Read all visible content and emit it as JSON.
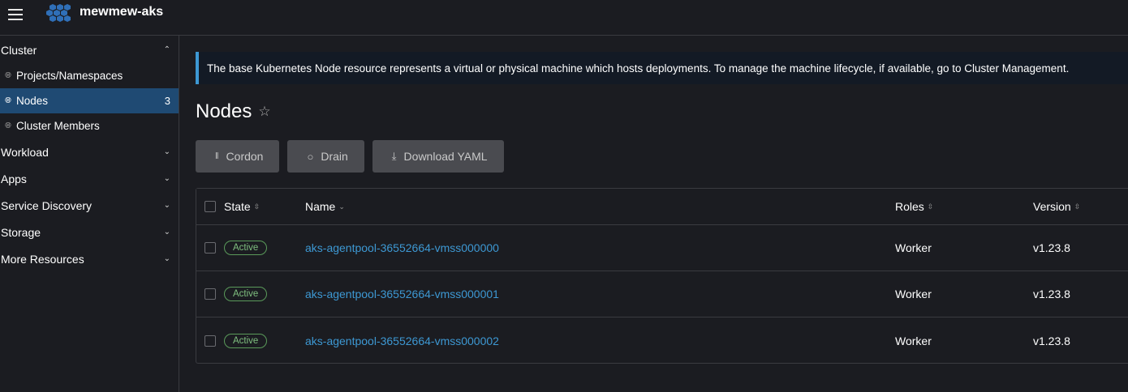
{
  "header": {
    "title": "mewmew-aks",
    "menu_icon": "hamburger-icon",
    "logo_icon": "kubernetes-cluster-logo"
  },
  "sidebar": {
    "groups": [
      {
        "label": "Cluster",
        "expanded": true,
        "items": [
          {
            "label": "Projects/Namespaces",
            "icon": "globe-icon"
          },
          {
            "label": "Nodes",
            "icon": "globe-icon",
            "count": "3",
            "active": true
          },
          {
            "label": "Cluster Members",
            "icon": "globe-icon"
          }
        ]
      },
      {
        "label": "Workload",
        "expanded": false
      },
      {
        "label": "Apps",
        "expanded": false
      },
      {
        "label": "Service Discovery",
        "expanded": false
      },
      {
        "label": "Storage",
        "expanded": false
      },
      {
        "label": "More Resources",
        "expanded": false
      }
    ]
  },
  "banner": {
    "text": "The base Kubernetes Node resource represents a virtual or physical machine which hosts deployments. To manage the machine lifecycle, if available, go to Cluster Management."
  },
  "page": {
    "title": "Nodes",
    "favorite_icon": "star-outline-icon"
  },
  "actions": {
    "cordon": "Cordon",
    "drain": "Drain",
    "download_yaml": "Download YAML"
  },
  "table": {
    "columns": {
      "state": "State",
      "name": "Name",
      "roles": "Roles",
      "version": "Version"
    },
    "rows": [
      {
        "state": "Active",
        "name": "aks-agentpool-36552664-vmss000000",
        "roles": "Worker",
        "version": "v1.23.8"
      },
      {
        "state": "Active",
        "name": "aks-agentpool-36552664-vmss000001",
        "roles": "Worker",
        "version": "v1.23.8"
      },
      {
        "state": "Active",
        "name": "aks-agentpool-36552664-vmss000002",
        "roles": "Worker",
        "version": "v1.23.8"
      }
    ]
  },
  "colors": {
    "accent": "#3d98d3",
    "active_nav": "#1f4a73",
    "status_active": "#7fbf7f",
    "background": "#1b1c21"
  }
}
